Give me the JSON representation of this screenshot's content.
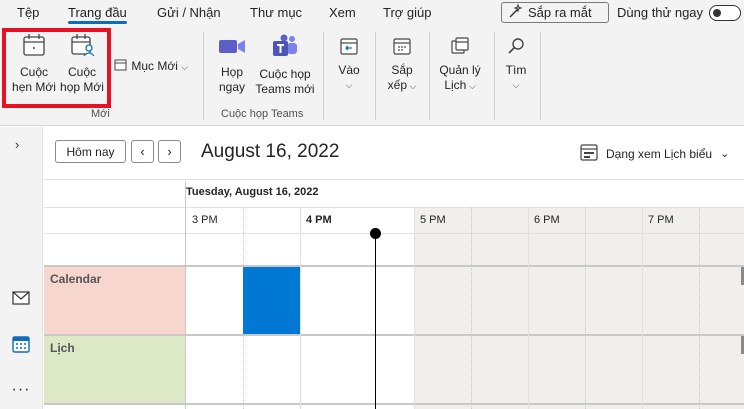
{
  "menu": {
    "tabs": [
      "Tệp",
      "Trang đầu",
      "Gửi / Nhận",
      "Thư mục",
      "Xem",
      "Trợ giúp"
    ],
    "coming_soon": "Sắp ra mắt",
    "try_now": "Dùng thử ngay"
  },
  "ribbon": {
    "new_appointment_line1": "Cuộc",
    "new_appointment_line2": "hẹn Mới",
    "new_meeting_line1": "Cuộc",
    "new_meeting_line2": "họp Mới",
    "new_items": "Mục Mới",
    "group_new": "Mới",
    "meet_now_line1": "Họp",
    "meet_now_line2": "ngay",
    "new_teams_line1": "Cuộc họp",
    "new_teams_line2": "Teams mới",
    "group_teams": "Cuộc họp Teams",
    "go_to": "Vào",
    "arrange_line1": "Sắp",
    "arrange_line2": "xếp",
    "manage_line1": "Quản lý",
    "manage_line2": "Lịch",
    "find": "Tìm"
  },
  "calendar": {
    "today_button": "Hôm nay",
    "date_title": "August 16, 2022",
    "view_label": "Dạng xem Lịch biểu",
    "day_header": "Tuesday, August 16, 2022",
    "hours": [
      "3 PM",
      "4 PM",
      "5 PM",
      "6 PM",
      "7 PM"
    ],
    "rows": [
      {
        "label": "Calendar",
        "color": "#f6d6cd"
      },
      {
        "label": "Lịch",
        "color": "#dde8c7"
      }
    ],
    "event_color": "#0078d4"
  },
  "colors": {
    "accent": "#0f6cbd",
    "highlight": "#e81123"
  }
}
